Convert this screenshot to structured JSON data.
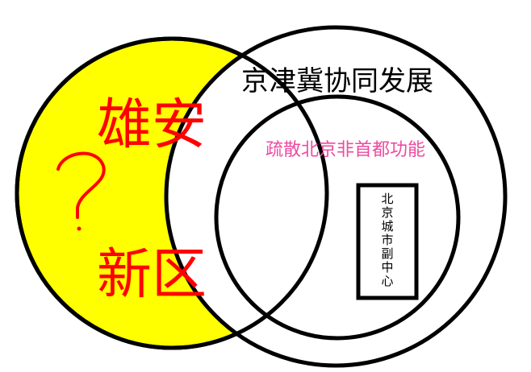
{
  "diagram": {
    "big_circle_label": "京津冀协同发展",
    "inner_circle_label": "疏散北京非首都功能",
    "box_label": "北京城市副中心",
    "left_label_top": "雄安",
    "left_label_bottom": "新区",
    "question_mark": "?"
  },
  "colors": {
    "highlight_fill": "#ffff00",
    "outline": "#000000",
    "red_text": "#ff0000",
    "pink_text": "#ee4aa0"
  }
}
